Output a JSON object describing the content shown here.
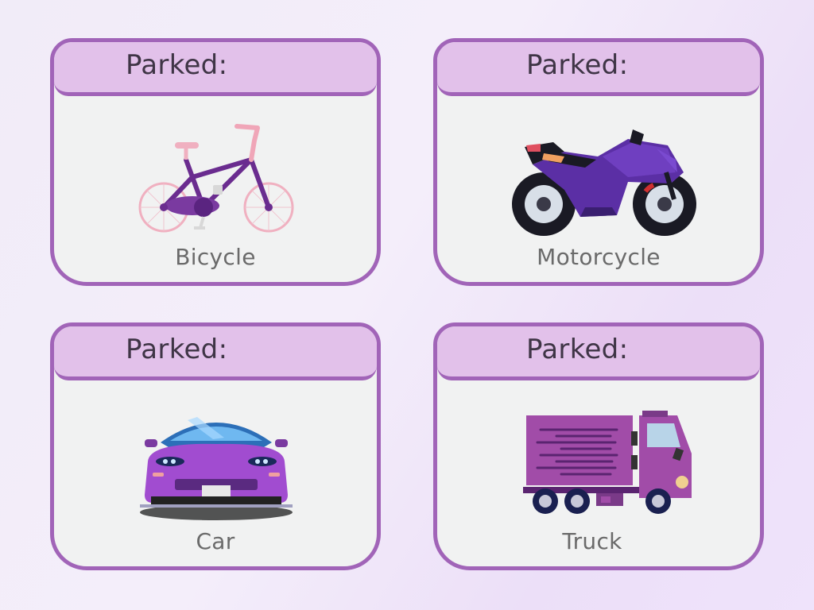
{
  "colors": {
    "card_border": "#a164b8",
    "card_header": "#e2c1ea",
    "card_body": "#f1f2f2",
    "header_text": "#3f3546",
    "label_text": "#6a6a6a"
  },
  "cards": [
    {
      "header": "Parked:",
      "vehicle": "Bicycle",
      "icon": "bicycle-icon"
    },
    {
      "header": "Parked:",
      "vehicle": "Motorcycle",
      "icon": "motorcycle-icon"
    },
    {
      "header": "Parked:",
      "vehicle": "Car",
      "icon": "car-icon"
    },
    {
      "header": "Parked:",
      "vehicle": "Truck",
      "icon": "truck-icon"
    }
  ]
}
